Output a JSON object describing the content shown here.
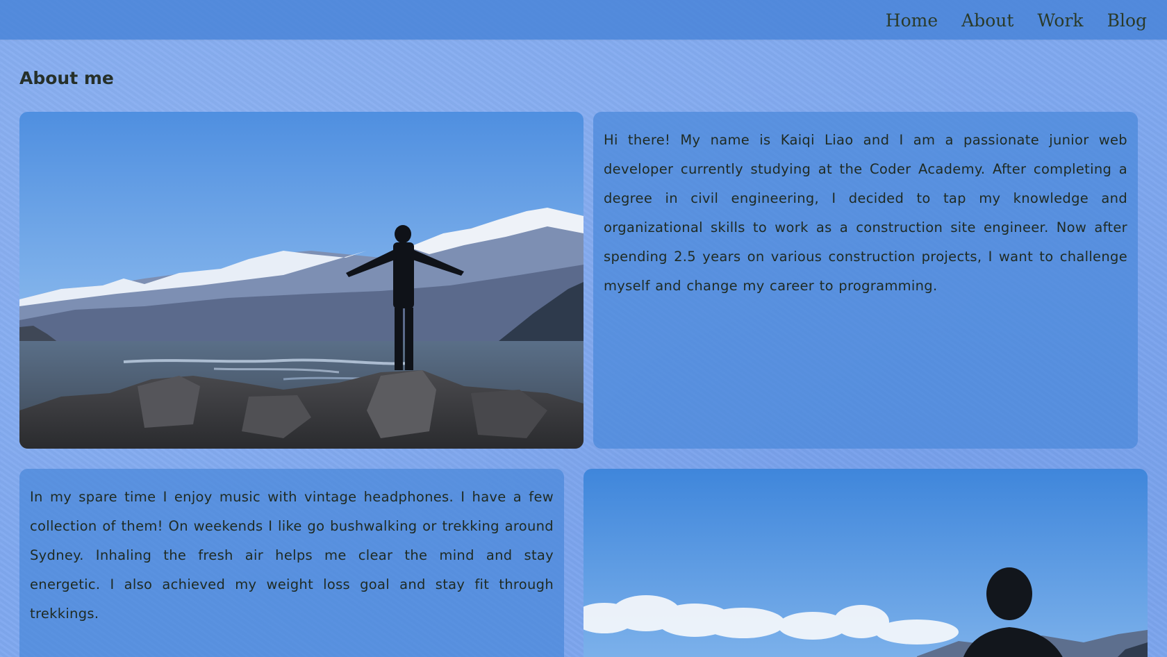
{
  "nav": {
    "items": [
      "Home",
      "About",
      "Work",
      "Blog"
    ]
  },
  "page": {
    "title": "About me"
  },
  "sections": {
    "intro_text": "Hi there! My name is Kaiqi Liao and I am a passionate junior web developer currently studying at the Coder Academy. After completing a degree in civil engineering, I decided to tap my knowledge and organizational skills to work as a construction site engineer. Now after spending 2.5 years on various construction projects, I want to challenge myself and change my career to programming.",
    "hobbies_text": "In my spare time I enjoy music with vintage headphones. I have a few collection of them! On weekends I like go bushwalking or trekking around Sydney. Inhaling the fresh air helps me clear the mind and stay energetic. I also achieved my weight loss goal and stay fit through trekkings."
  },
  "colors": {
    "background": "#7fa8ef",
    "navbar": "#4682d7",
    "card": "#4a88da",
    "text": "#243024"
  }
}
